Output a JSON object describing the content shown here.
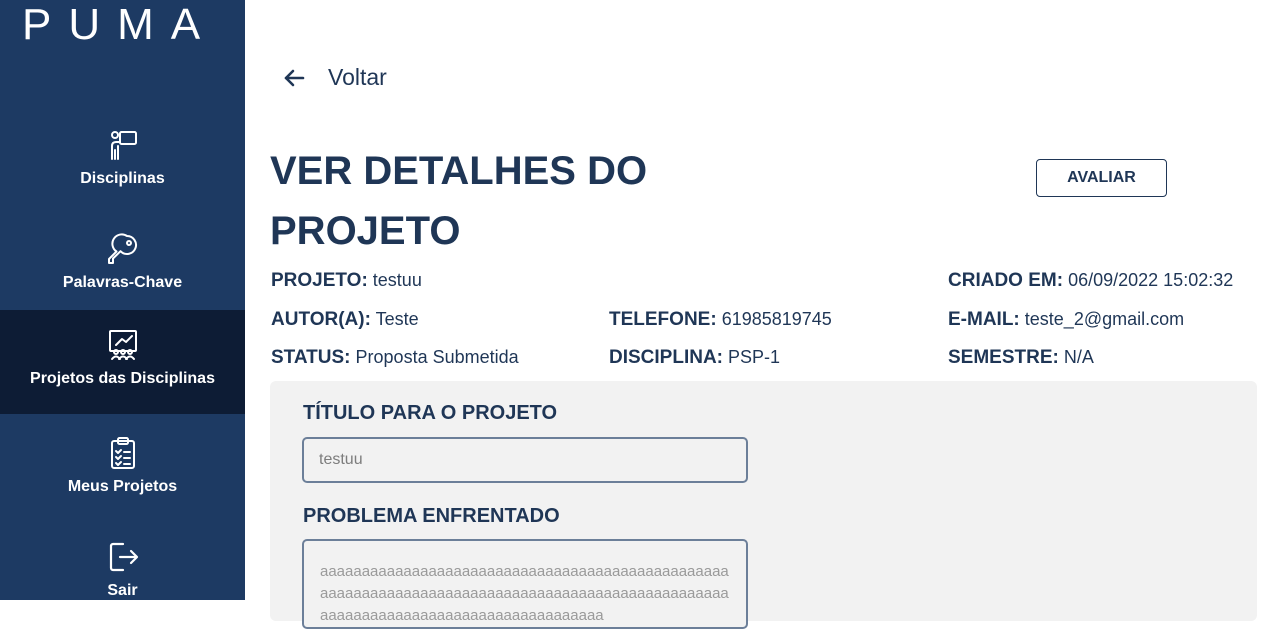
{
  "app": {
    "logo": "PUMA"
  },
  "sidebar": {
    "items": [
      {
        "label": "Disciplinas",
        "icon": "teacher-board-icon",
        "active": false
      },
      {
        "label": "Palavras-Chave",
        "icon": "key-icon",
        "active": false
      },
      {
        "label": "Projetos das Disciplinas",
        "icon": "class-presentation-icon",
        "active": true
      },
      {
        "label": "Meus Projetos",
        "icon": "clipboard-checklist-icon",
        "active": false
      },
      {
        "label": "Sair",
        "icon": "logout-icon",
        "active": false
      }
    ]
  },
  "header": {
    "back_label": "Voltar",
    "title": "VER DETALHES DO PROJETO",
    "evaluate_label": "AVALIAR"
  },
  "details": {
    "projeto": {
      "label": "PROJETO:",
      "value": "testuu"
    },
    "criado_em": {
      "label": "CRIADO EM:",
      "value": "06/09/2022 15:02:32"
    },
    "autor": {
      "label": "AUTOR(A):",
      "value": "Teste"
    },
    "telefone": {
      "label": "TELEFONE:",
      "value": "61985819745"
    },
    "email": {
      "label": "E-MAIL:",
      "value": "teste_2@gmail.com"
    },
    "status": {
      "label": "STATUS:",
      "value": "Proposta Submetida"
    },
    "disciplina": {
      "label": "DISCIPLINA:",
      "value": "PSP-1"
    },
    "semestre": {
      "label": "SEMESTRE:",
      "value": "N/A"
    }
  },
  "form": {
    "titulo_label": "TÍTULO PARA O PROJETO",
    "titulo_value": "testuu",
    "problema_label": "PROBLEMA ENFRENTADO",
    "problema_value": "aaaaaaaaaaaaaaaaaaaaaaaaaaaaaaaaaaaaaaaaaaaaaaaaaaaaaaaaaaaaaaaaaaaaaaaaaaaaaaaaaaaaaaaaaaaaaaaaaaaaaaaaaaaaaaaaaaaaaaaaaaaaaaaaaaaa"
  },
  "colors": {
    "sidebar_bg": "#1d3a63",
    "sidebar_active_bg": "#0d1c35",
    "text_primary": "#1f3656",
    "panel_bg": "#f2f2f2"
  }
}
